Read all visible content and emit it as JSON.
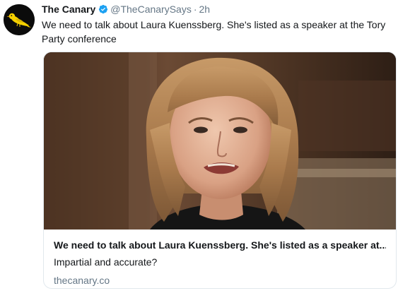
{
  "tweet": {
    "author": {
      "display_name": "The Canary",
      "handle": "@TheCanarySays",
      "separator": "·",
      "time": "2h",
      "avatar_icon": "canary-bird-icon",
      "verified_icon": "verified-badge-icon"
    },
    "text": "We need to talk about Laura Kuenssberg. She's listed as a speaker at the Tory Party conference"
  },
  "card": {
    "image_icon": "woman-portrait-photo",
    "title": "We need to talk about Laura Kuenssberg. She's listed as a speaker at...",
    "description": "Impartial and accurate?",
    "domain": "thecanary.co"
  },
  "colors": {
    "accent_verified": "#1da1f2",
    "canary_yellow": "#f5d000",
    "muted_text": "#657786",
    "primary_text": "#14171a",
    "card_border": "#e1e8ed"
  }
}
